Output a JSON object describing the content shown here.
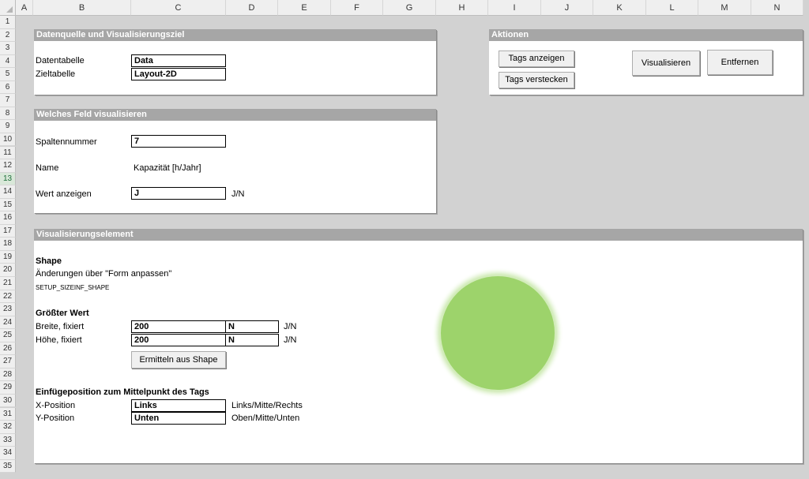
{
  "columns": [
    "A",
    "B",
    "C",
    "D",
    "E",
    "F",
    "G",
    "H",
    "I",
    "J",
    "K",
    "L",
    "M",
    "N"
  ],
  "rows": [
    "1",
    "2",
    "3",
    "4",
    "5",
    "6",
    "7",
    "8",
    "9",
    "10",
    "11",
    "12",
    "13",
    "14",
    "15",
    "16",
    "17",
    "18",
    "19",
    "20",
    "21",
    "22",
    "23",
    "24",
    "25",
    "26",
    "27",
    "28",
    "29",
    "30",
    "31",
    "32",
    "33",
    "34",
    "35"
  ],
  "selected_row": "13",
  "source": {
    "title": "Datenquelle und Visualisierungsziel",
    "data_table_label": "Datentabelle",
    "data_table_value": "Data",
    "target_table_label": "Zieltabelle",
    "target_table_value": "Layout-2D"
  },
  "field": {
    "title": "Welches Feld visualisieren",
    "column_label": "Spaltennummer",
    "column_value": "7",
    "name_label": "Name",
    "name_value": "Kapazität [h/Jahr]",
    "show_value_label": "Wert anzeigen",
    "show_value_value": "J",
    "show_value_hint": "J/N"
  },
  "actions": {
    "title": "Aktionen",
    "show_tags": "Tags anzeigen",
    "hide_tags": "Tags verstecken",
    "visualize": "Visualisieren",
    "remove": "Entfernen"
  },
  "element": {
    "title": "Visualisierungselement",
    "shape_heading": "Shape",
    "shape_hint": "Änderungen über \"Form anpassen\"",
    "shape_name": "SETUP_SIZEINF_SHAPE",
    "max_heading": "Größter Wert",
    "width_label": "Breite, fixiert",
    "width_value": "200",
    "width_fixed": "N",
    "width_hint": "J/N",
    "height_label": "Höhe, fixiert",
    "height_value": "200",
    "height_fixed": "N",
    "height_hint": "J/N",
    "determine_button": "Ermitteln aus Shape",
    "insert_heading": "Einfügeposition zum Mittelpunkt des Tags",
    "x_label": "X-Position",
    "x_value": "Links",
    "x_hint": "Links/Mitte/Rechts",
    "y_label": "Y-Position",
    "y_value": "Unten",
    "y_hint": "Oben/Mitte/Unten"
  },
  "colors": {
    "panel_header": "#a6a6a6",
    "sheet_background": "#d2d2d2",
    "shape_fill": "#9dd36b",
    "shape_glow": "#d3ecbb"
  }
}
